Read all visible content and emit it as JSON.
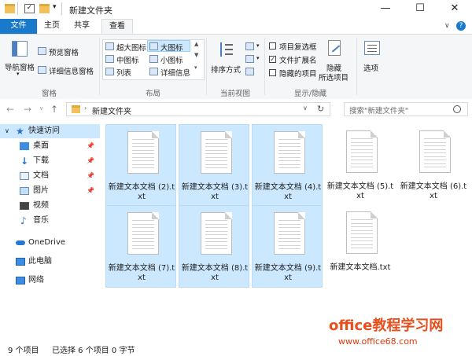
{
  "window": {
    "title": "新建文件夹",
    "minimize": "—",
    "maximize": "☐",
    "close": "✕"
  },
  "tabs": [
    {
      "label": "文件"
    },
    {
      "label": "主页"
    },
    {
      "label": "共享"
    },
    {
      "label": "查看"
    }
  ],
  "ribbon": {
    "pane": {
      "nav_pane": "导航窗格",
      "preview_pane": "预览窗格",
      "details_pane": "详细信息窗格",
      "group": "窗格"
    },
    "layout": {
      "xl_icons": "超大图标",
      "l_icons": "大图标",
      "m_icons": "中图标",
      "s_icons": "小图标",
      "list": "列表",
      "details": "详细信息",
      "group": "布局"
    },
    "current_view": {
      "sort_by": "排序方式",
      "group": "当前视图"
    },
    "show_hide": {
      "item_checkboxes": "项目复选框",
      "file_extensions": "文件扩展名",
      "hidden_items": "隐藏的项目",
      "hide_selected_1": "隐藏",
      "hide_selected_2": "所选项目",
      "group": "显示/隐藏"
    },
    "options": "选项"
  },
  "nav": {
    "address": "新建文件夹",
    "search_placeholder": "搜索\"新建文件夹\""
  },
  "sidebar": {
    "quick_access": "快速访问",
    "items": [
      {
        "label": "桌面",
        "pinned": true
      },
      {
        "label": "下载",
        "pinned": true
      },
      {
        "label": "文档",
        "pinned": true
      },
      {
        "label": "图片",
        "pinned": true
      },
      {
        "label": "视频",
        "pinned": false
      },
      {
        "label": "音乐",
        "pinned": false
      }
    ],
    "onedrive": "OneDrive",
    "this_pc": "此电脑",
    "network": "网络"
  },
  "files": [
    {
      "name": "新建文本文档 (2).txt",
      "selected": true
    },
    {
      "name": "新建文本文档 (3).txt",
      "selected": true
    },
    {
      "name": "新建文本文档 (4).txt",
      "selected": true
    },
    {
      "name": "新建文本文档 (5).txt",
      "selected": false
    },
    {
      "name": "新建文本文档 (6).txt",
      "selected": false
    },
    {
      "name": "新建文本文档 (7).txt",
      "selected": true
    },
    {
      "name": "新建文本文档 (8).txt",
      "selected": true
    },
    {
      "name": "新建文本文档 (9).txt",
      "selected": true
    },
    {
      "name": "新建文本文档.txt",
      "selected": false
    }
  ],
  "status": {
    "item_count": "9 个项目",
    "selection": "已选择 6 个项目 0 字节"
  },
  "watermark": {
    "brand": "office教程学习网",
    "url": "www.office68.com"
  },
  "colors": {
    "accent": "#1979ca",
    "selection": "#cce8ff",
    "watermark": "#e84f1c"
  }
}
